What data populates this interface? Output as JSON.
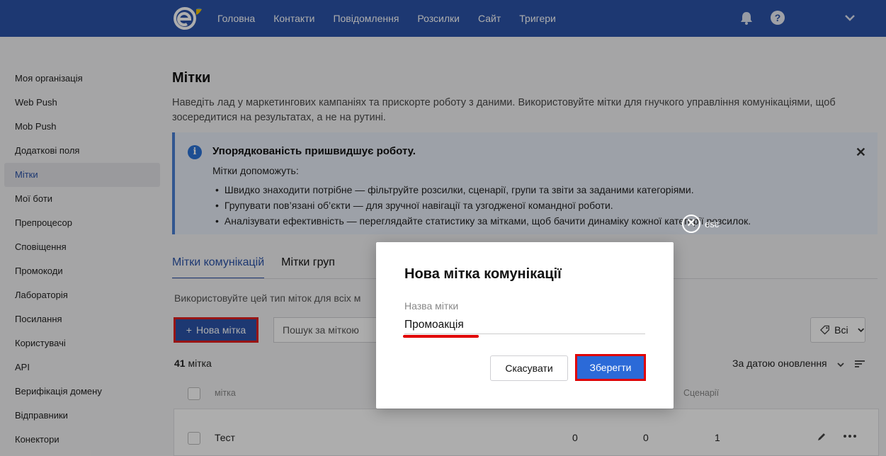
{
  "topnav": {
    "items": [
      "Головна",
      "Контакти",
      "Повідомлення",
      "Розсилки",
      "Сайт",
      "Тригери"
    ]
  },
  "sidebar": {
    "items": [
      {
        "label": "Моя організація"
      },
      {
        "label": "Web Push"
      },
      {
        "label": "Mob Push"
      },
      {
        "label": "Додаткові поля"
      },
      {
        "label": "Мітки",
        "active": true
      },
      {
        "label": "Мої боти"
      },
      {
        "label": "Препроцесор"
      },
      {
        "label": "Сповіщення"
      },
      {
        "label": "Промокоди"
      },
      {
        "label": "Лабораторія"
      },
      {
        "label": "Посилання"
      },
      {
        "label": "Користувачі"
      },
      {
        "label": "API"
      },
      {
        "label": "Верифікація домену"
      },
      {
        "label": "Відправники"
      },
      {
        "label": "Конектори"
      }
    ]
  },
  "page": {
    "title": "Мітки",
    "description": "Наведіть лад у маркетингових кампаніях та прискорте роботу з даними. Використовуйте мітки для гнучкого управління комунікаціями, щоб зосередитися на результатах, а не на рутині."
  },
  "info": {
    "title": "Упорядкованість пришвидшує роботу.",
    "subtitle": "Мітки допоможуть:",
    "items": [
      "Швидко знаходити потрібне — фільтруйте розсилки, сценарії, групи та звіти за заданими категоріями.",
      "Групувати пов’язані об’єкти — для зручної навігації та узгодженої командної роботи.",
      "Аналізувати ефективність — переглядайте статистику за мітками, щоб бачити динаміку кожної категорії розсилок."
    ]
  },
  "tabs": [
    "Мітки комунікацій",
    "Мітки груп"
  ],
  "hint": "Використовуйте цей тип міток для всіх м",
  "toolbar": {
    "new_label": "Нова мітка",
    "search_placeholder": "Пошук за міткою",
    "filter_label": "Всі"
  },
  "list": {
    "count_number": "41",
    "count_word": "мітка",
    "sort_label": "За датою оновлення",
    "col_label": "мітка",
    "col_scenarios": "Сценарії",
    "rows": [
      {
        "name": "Тест",
        "v1": "0",
        "v2": "0",
        "v3": "1"
      }
    ]
  },
  "modal": {
    "esc_label": "esc",
    "title": "Нова мітка комунікації",
    "field_label": "Назва мітки",
    "field_value": "Промоакція",
    "cancel_label": "Скасувати",
    "save_label": "Зберегти"
  }
}
